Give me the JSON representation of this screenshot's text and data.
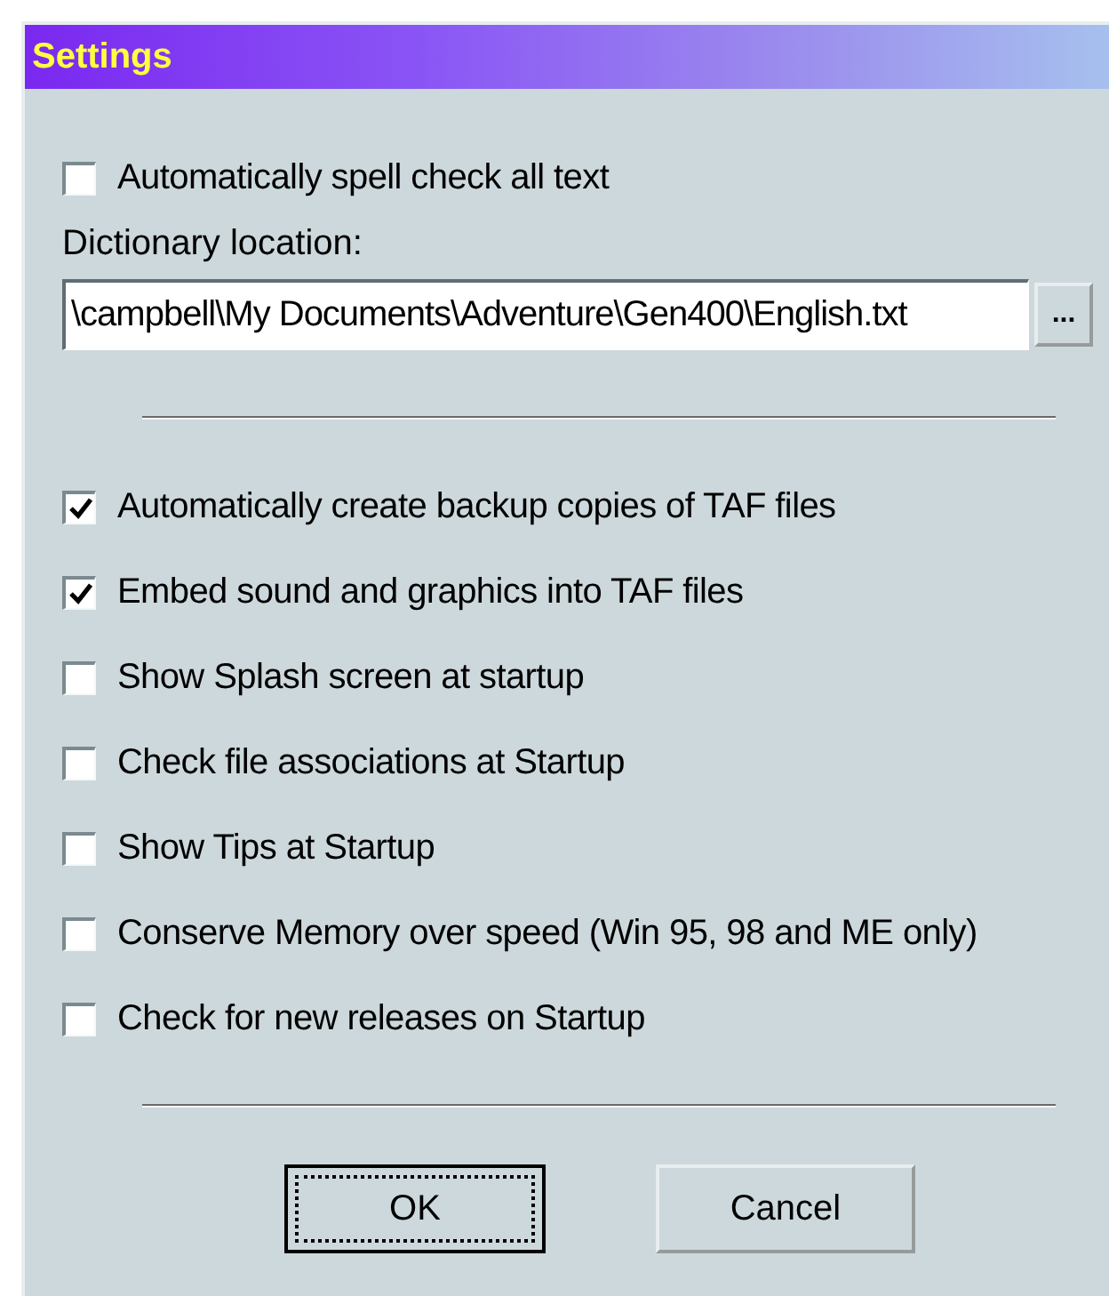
{
  "window": {
    "title": "Settings"
  },
  "spell_check": {
    "label": "Automatically spell check all text",
    "checked": false
  },
  "dictionary": {
    "label": "Dictionary location:",
    "value": "\\campbell\\My Documents\\Adventure\\Gen400\\English.txt",
    "browse": "..."
  },
  "options": [
    {
      "label": "Automatically create backup copies of TAF files",
      "checked": true
    },
    {
      "label": "Embed sound and graphics into TAF files",
      "checked": true
    },
    {
      "label": "Show Splash screen at startup",
      "checked": false
    },
    {
      "label": "Check file associations at Startup",
      "checked": false
    },
    {
      "label": "Show Tips at Startup",
      "checked": false
    },
    {
      "label": "Conserve Memory over speed (Win 95, 98 and ME only)",
      "checked": false
    },
    {
      "label": "Check for new releases on Startup",
      "checked": false
    }
  ],
  "buttons": [
    {
      "label": "OK",
      "default": true
    },
    {
      "label": "Cancel",
      "default": false
    }
  ]
}
